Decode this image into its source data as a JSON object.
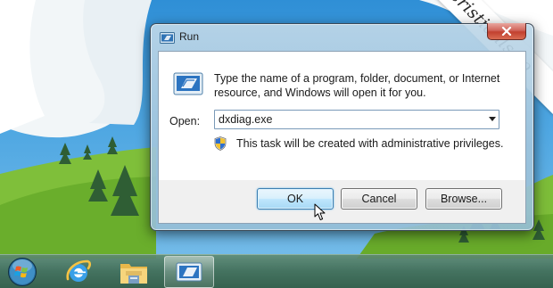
{
  "watermark": {
    "text": "cristianls.ro"
  },
  "dialog": {
    "title": "Run",
    "description": "Type the name of a program, folder, document, or Internet resource, and Windows will open it for you.",
    "open_label": "Open:",
    "open_value": "dxdiag.exe",
    "admin_note": "This task will be created with administrative privileges.",
    "buttons": {
      "ok": "OK",
      "cancel": "Cancel",
      "browse": "Browse..."
    }
  },
  "taskbar": {
    "items": [
      "start-orb",
      "internet-explorer-icon",
      "windows-explorer-icon",
      "run-icon"
    ],
    "active": "run-icon"
  },
  "colors": {
    "taskbar": "#4b7a63",
    "dialog_frame": "#a9c8de",
    "close_button": "#c94a3a",
    "ok_button_border": "#3c7fb1"
  }
}
